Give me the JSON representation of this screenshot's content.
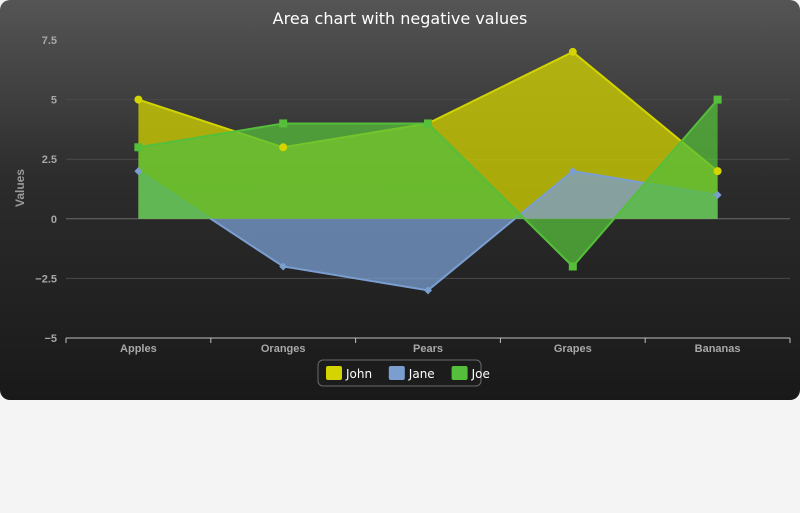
{
  "chart_data": {
    "type": "area",
    "title": "Area chart with negative values",
    "xlabel": "",
    "ylabel": "Values",
    "categories": [
      "Apples",
      "Oranges",
      "Pears",
      "Grapes",
      "Bananas"
    ],
    "ylim": [
      -5,
      7.5
    ],
    "yticks": [
      {
        "value": 7.5,
        "label": "7.5"
      },
      {
        "value": 5,
        "label": "5"
      },
      {
        "value": 2.5,
        "label": "2.5"
      },
      {
        "value": 0,
        "label": "0"
      },
      {
        "value": -2.5,
        "label": "−2.5"
      },
      {
        "value": -5,
        "label": "−5"
      }
    ],
    "grid": true,
    "legend_position": "bottom-center",
    "series": [
      {
        "name": "John",
        "values": [
          5,
          3,
          4,
          7,
          2
        ],
        "color": "#d4d400",
        "marker": "circle"
      },
      {
        "name": "Jane",
        "values": [
          2,
          -2,
          -3,
          2,
          1
        ],
        "color": "#7a9ed0",
        "marker": "diamond"
      },
      {
        "name": "Joe",
        "values": [
          3,
          4,
          4,
          -2,
          5
        ],
        "color": "#55bf3b",
        "marker": "square"
      }
    ]
  }
}
